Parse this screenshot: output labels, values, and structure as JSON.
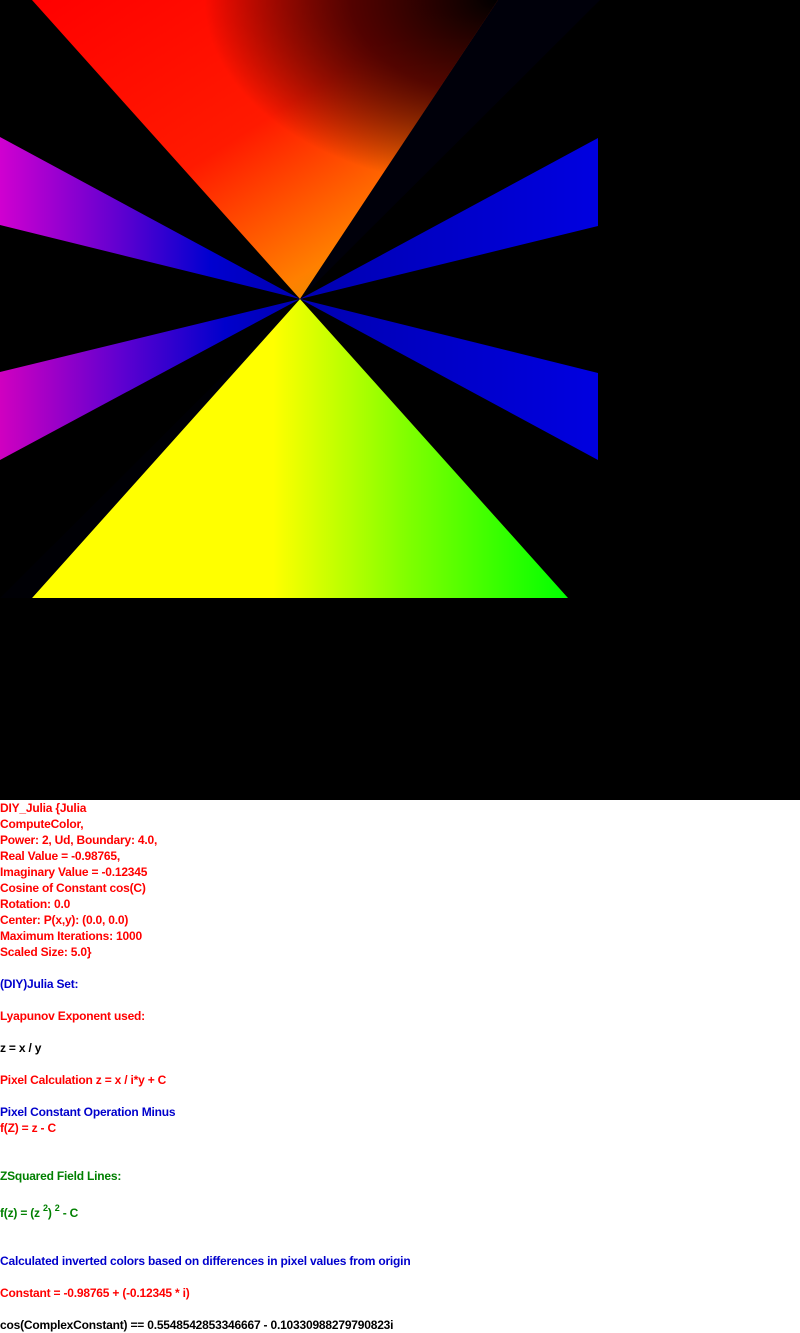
{
  "colors": {
    "red": "#ff0000",
    "blue": "#0000cc",
    "black": "#000000",
    "green": "#008000",
    "background": "#000000"
  },
  "info": {
    "settings": [
      "DIY_Julia {Julia",
      "ComputeColor,",
      "Power: 2, Ud, Boundary: 4.0,",
      "Real Value = -0.98765,",
      "Imaginary Value = -0.12345",
      "Cosine of Constant cos(C)",
      "Rotation: 0.0",
      "Center: P(x,y): (0.0, 0.0)",
      "Maximum Iterations: 1000",
      "Scaled Size: 5.0}"
    ],
    "set_title": "(DIY)Julia Set:",
    "lyapunov": "Lyapunov Exponent used:",
    "z_formula": "z = x / y",
    "pixel_calc": "Pixel Calculation z = x / i*y + C",
    "pixel_op": "Pixel Constant Operation Minus",
    "f_z": "f(Z) = z - C",
    "field_lines": "ZSquared Field Lines:",
    "fz_prefix": "f(z) = (z ",
    "fz_sup1": "2",
    "fz_mid": ") ",
    "fz_sup2": "2",
    "fz_suffix": " - C",
    "inverted_colors": "Calculated inverted colors based on differences in pixel values from origin",
    "constant": "Constant = -0.98765 + (-0.12345 * i)",
    "cos_constant": "cos(ComplexConstant) == 0.5548542853346667 - 0.10330988279790823i"
  }
}
